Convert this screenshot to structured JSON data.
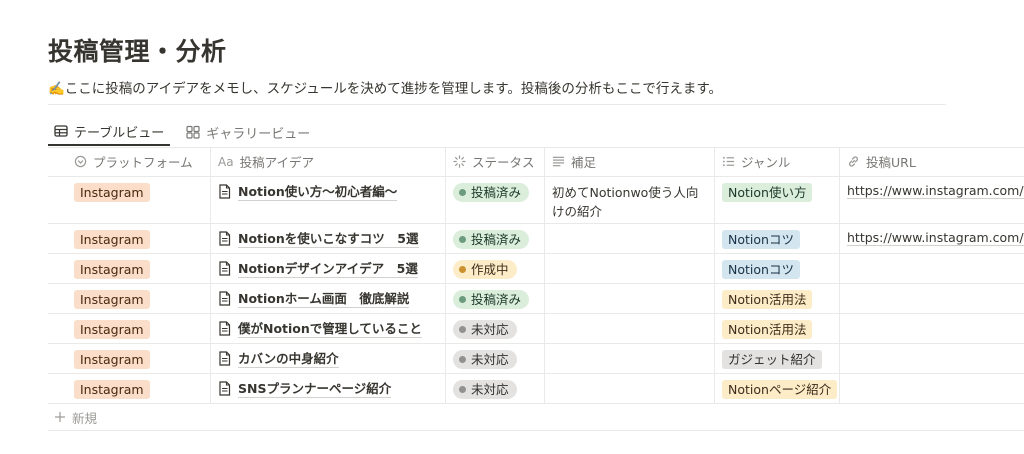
{
  "page": {
    "title": "投稿管理・分析",
    "description": "✍️ここに投稿のアイデアをメモし、スケジュールを決めて進捗を管理します。投稿後の分析もここで行えます。"
  },
  "tabs": [
    {
      "label": "テーブルビュー",
      "icon": "table-icon",
      "active": true
    },
    {
      "label": "ギャラリービュー",
      "icon": "gallery-icon",
      "active": false
    }
  ],
  "columns": [
    {
      "label": "プラットフォーム",
      "icon": "select-icon"
    },
    {
      "label": "投稿アイデア",
      "icon": "title-aa-icon",
      "icon_text": "Aa"
    },
    {
      "label": "ステータス",
      "icon": "status-icon"
    },
    {
      "label": "補足",
      "icon": "text-lines-icon"
    },
    {
      "label": "ジャンル",
      "icon": "list-icon"
    },
    {
      "label": "投稿URL",
      "icon": "link-icon"
    }
  ],
  "rows": [
    {
      "platform": "Instagram",
      "idea": "Notion使い方〜初心者編〜",
      "status": "投稿済み",
      "status_type": "done",
      "note": "初めてNotionwo使う人向けの紹介",
      "genre": "Notion使い方",
      "genre_color": "green",
      "url": "https://www.instagram.com/"
    },
    {
      "platform": "Instagram",
      "idea": "Notionを使いこなすコツ　5選",
      "status": "投稿済み",
      "status_type": "done",
      "note": "",
      "genre": "Notionコツ",
      "genre_color": "blue",
      "url": "https://www.instagram.com/"
    },
    {
      "platform": "Instagram",
      "idea": "Notionデザインアイデア　5選",
      "status": "作成中",
      "status_type": "prog",
      "note": "",
      "genre": "Notionコツ",
      "genre_color": "blue",
      "url": ""
    },
    {
      "platform": "Instagram",
      "idea": "Notionホーム画面　徹底解説",
      "status": "投稿済み",
      "status_type": "done",
      "note": "",
      "genre": "Notion活用法",
      "genre_color": "yellow",
      "url": ""
    },
    {
      "platform": "Instagram",
      "idea": "僕がNotionで管理していること",
      "status": "未対応",
      "status_type": "none",
      "note": "",
      "genre": "Notion活用法",
      "genre_color": "yellow",
      "url": ""
    },
    {
      "platform": "Instagram",
      "idea": "カバンの中身紹介",
      "status": "未対応",
      "status_type": "none",
      "note": "",
      "genre": "ガジェット紹介",
      "genre_color": "gray",
      "url": ""
    },
    {
      "platform": "Instagram",
      "idea": "SNSプランナーページ紹介",
      "status": "未対応",
      "status_type": "none",
      "note": "",
      "genre": "Notionページ紹介",
      "genre_color": "yellow",
      "url": ""
    }
  ],
  "new_row_label": "新規",
  "colors": {
    "platform_tag": "#fadec9",
    "done": "#dbeddb",
    "in_progress": "#fdecc8",
    "not_started": "#e3e2e0"
  }
}
